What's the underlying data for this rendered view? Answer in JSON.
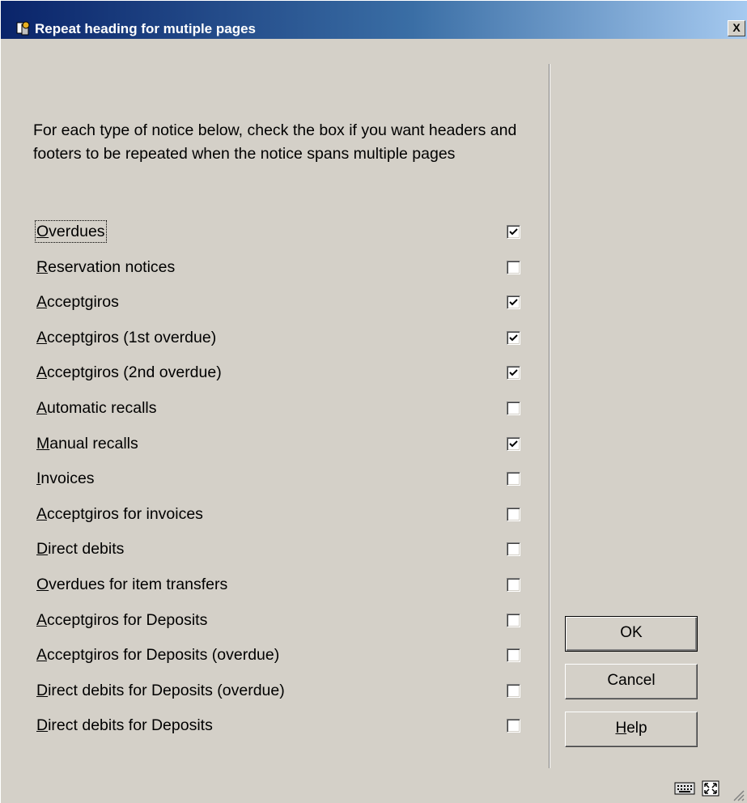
{
  "window": {
    "title": "Repeat heading for mutiple pages",
    "close_label": "X"
  },
  "intro": {
    "text": "For each type of notice below, check the box if you want headers and footers to be repeated when the notice spans multiple pages"
  },
  "notices": [
    {
      "first": "O",
      "rest": "verdues",
      "checked": true
    },
    {
      "first": "R",
      "rest": "eservation notices",
      "checked": false
    },
    {
      "first": "A",
      "rest": "cceptgiros",
      "checked": true
    },
    {
      "first": "A",
      "rest": "cceptgiros (1st overdue)",
      "checked": true
    },
    {
      "first": "A",
      "rest": "cceptgiros (2nd overdue)",
      "checked": true
    },
    {
      "first": "A",
      "rest": "utomatic recalls",
      "checked": false
    },
    {
      "first": "M",
      "rest": "anual recalls",
      "checked": true
    },
    {
      "first": "I",
      "rest": "nvoices",
      "checked": false
    },
    {
      "first": "A",
      "rest": "cceptgiros for invoices",
      "checked": false
    },
    {
      "first": "D",
      "rest": "irect debits",
      "checked": false
    },
    {
      "first": "O",
      "rest": "verdues for item transfers",
      "checked": false
    },
    {
      "first": "A",
      "rest": "cceptgiros for Deposits",
      "checked": false
    },
    {
      "first": "A",
      "rest": "cceptgiros for Deposits (overdue)",
      "checked": false
    },
    {
      "first": "D",
      "rest": "irect debits for Deposits (overdue)",
      "checked": false
    },
    {
      "first": "D",
      "rest": "irect debits for Deposits",
      "checked": false
    }
  ],
  "buttons": {
    "ok": "OK",
    "cancel": "Cancel",
    "help_first": "H",
    "help_rest": "elp"
  },
  "icons": {
    "app": "library-books-icon",
    "status_left": "keyboard-icon",
    "status_right": "resize-window-icon"
  }
}
